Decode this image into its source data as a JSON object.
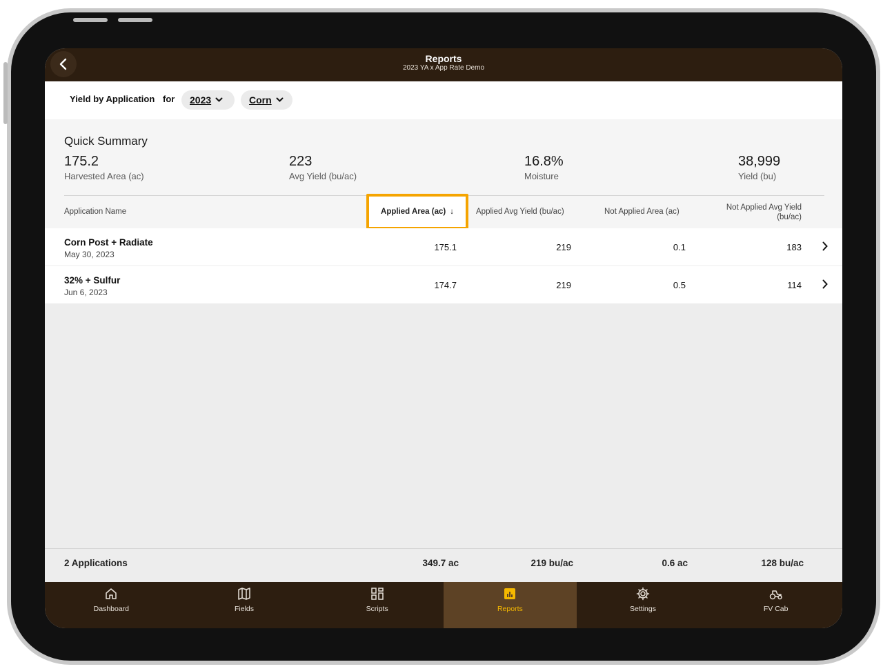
{
  "header": {
    "title": "Reports",
    "subtitle": "2023 YA x App Rate Demo"
  },
  "filter": {
    "report_label": "Yield by Application",
    "for_label": "for",
    "year": "2023",
    "crop": "Corn"
  },
  "summary": {
    "title": "Quick Summary",
    "stats": [
      {
        "value": "175.2",
        "label": "Harvested Area (ac)"
      },
      {
        "value": "223",
        "label": "Avg Yield (bu/ac)"
      },
      {
        "value": "16.8%",
        "label": "Moisture"
      },
      {
        "value": "38,999",
        "label": "Yield (bu)"
      }
    ]
  },
  "table": {
    "columns": {
      "name": "Application Name",
      "applied_area": "Applied Area (ac)",
      "applied_avg_yield": "Applied Avg Yield (bu/ac)",
      "not_applied_area": "Not Applied Area (ac)",
      "not_applied_avg_yield_1": "Not Applied Avg Yield",
      "not_applied_avg_yield_2": "(bu/ac)"
    },
    "sort_indicator": "↓",
    "rows": [
      {
        "name": "Corn Post + Radiate",
        "date": "May 30, 2023",
        "applied_area": "175.1",
        "applied_avg_yield": "219",
        "not_applied_area": "0.1",
        "not_applied_avg_yield": "183"
      },
      {
        "name": "32% + Sulfur",
        "date": "Jun 6, 2023",
        "applied_area": "174.7",
        "applied_avg_yield": "219",
        "not_applied_area": "0.5",
        "not_applied_avg_yield": "114"
      }
    ]
  },
  "footer": {
    "count": "2 Applications",
    "applied_area": "349.7 ac",
    "applied_avg_yield": "219 bu/ac",
    "not_applied_area": "0.6 ac",
    "not_applied_avg_yield": "128 bu/ac"
  },
  "tabs": [
    {
      "label": "Dashboard",
      "icon": "home-icon"
    },
    {
      "label": "Fields",
      "icon": "map-icon"
    },
    {
      "label": "Scripts",
      "icon": "grid-icon"
    },
    {
      "label": "Reports",
      "icon": "chart-icon",
      "active": true
    },
    {
      "label": "Settings",
      "icon": "gear-icon"
    },
    {
      "label": "FV Cab",
      "icon": "tractor-icon"
    }
  ],
  "colors": {
    "header_bg": "#2d1e10",
    "active_tab_bg": "#5d4225",
    "accent": "#f5b800",
    "highlight_border": "#f5a400"
  }
}
